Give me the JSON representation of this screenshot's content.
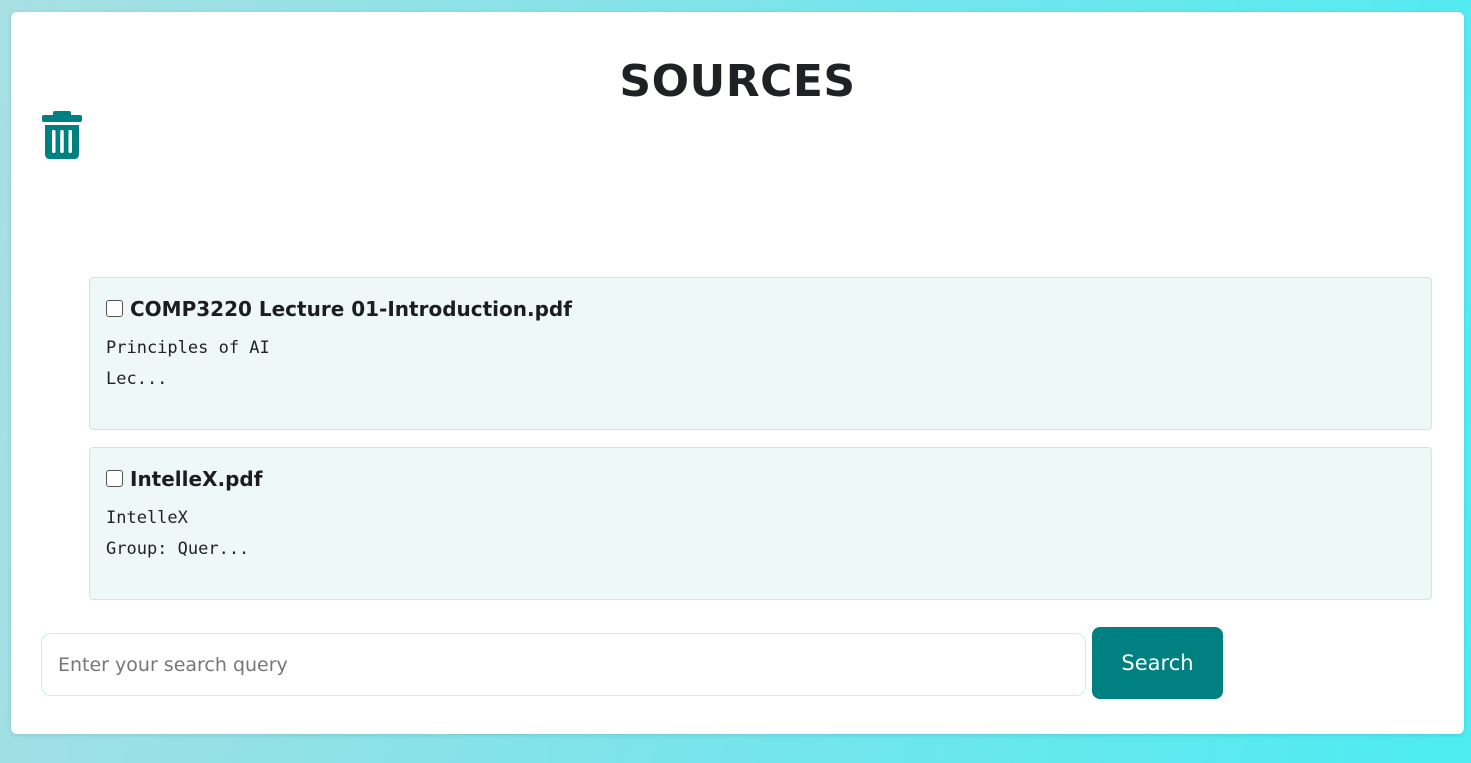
{
  "page": {
    "title": "SOURCES"
  },
  "toolbar": {
    "delete_icon": "trash-icon",
    "delete_color": "#008080"
  },
  "sources": [
    {
      "title": "COMP3220 Lecture 01-Introduction.pdf",
      "checked": false,
      "preview_line1": "Principles of AI",
      "preview_line2": "Lec..."
    },
    {
      "title": "IntelleX.pdf",
      "checked": false,
      "preview_line1": "IntelleX",
      "preview_line2": "Group: Quer..."
    }
  ],
  "search": {
    "placeholder": "Enter your search query",
    "value": "",
    "button_label": "Search",
    "button_color": "#008080"
  }
}
